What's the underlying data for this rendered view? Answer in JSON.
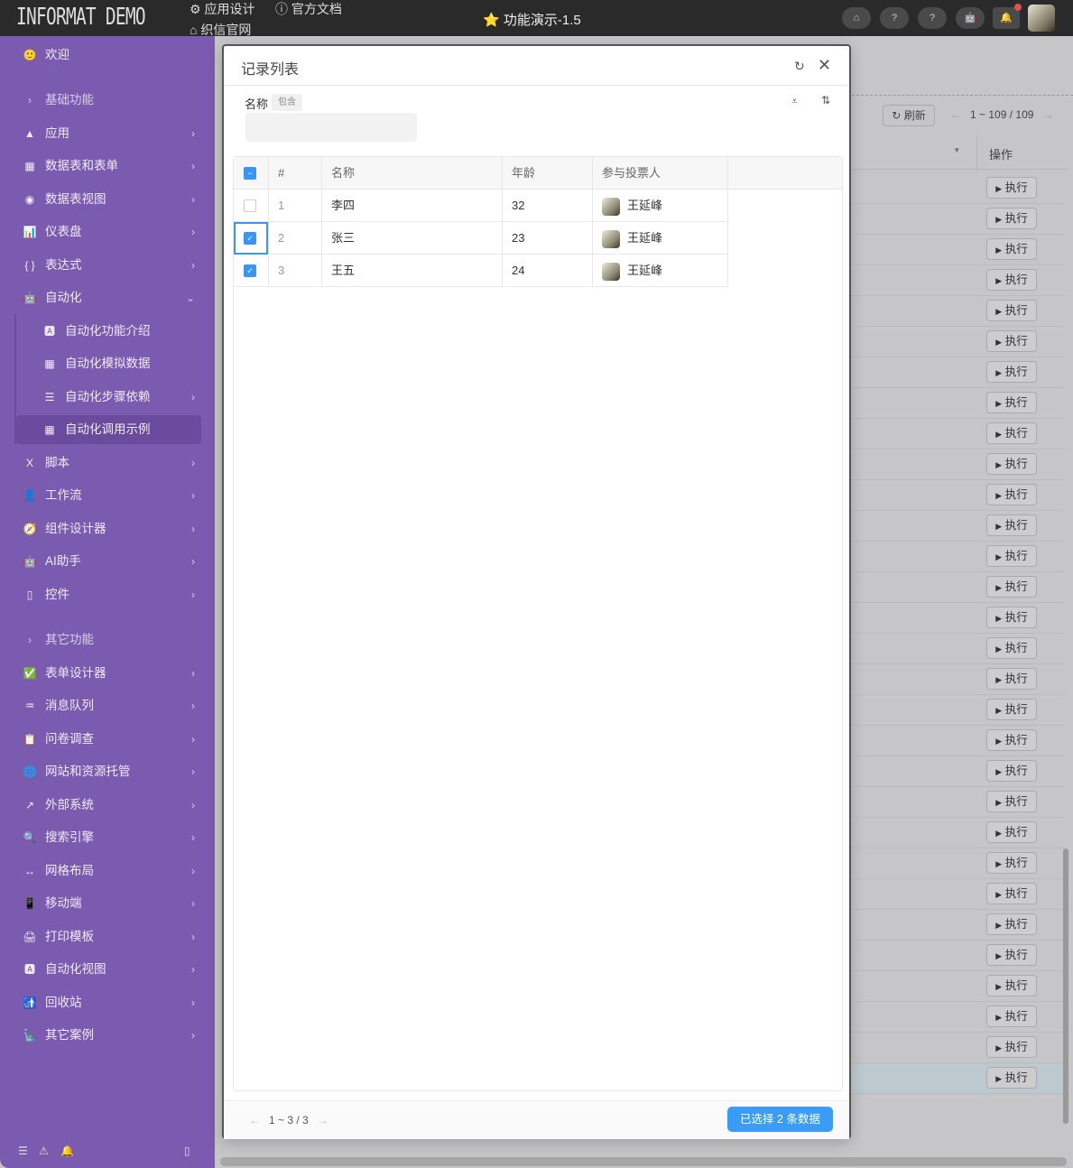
{
  "topbar": {
    "logo": "INFORMAT DEMO",
    "links": [
      {
        "icon": "gear-icon",
        "label": "应用设计"
      },
      {
        "icon": "info-icon",
        "label": "官方文档"
      },
      {
        "icon": "home-icon",
        "label": "织信官网"
      }
    ],
    "title": "功能演示-1.5",
    "title_icon": "⭐",
    "buttons": [
      {
        "name": "home",
        "icon": "⌂"
      },
      {
        "name": "feedback",
        "icon": "?"
      },
      {
        "name": "help",
        "icon": "?"
      },
      {
        "name": "robot",
        "icon": "🤖"
      },
      {
        "name": "notifications",
        "icon": "🔔"
      }
    ]
  },
  "sidebar": {
    "items": [
      {
        "icon": "🙂",
        "label": "欢迎",
        "type": "item"
      },
      {
        "icon": "›",
        "label": "基础功能",
        "type": "section"
      },
      {
        "icon": "▲",
        "label": "应用",
        "type": "item",
        "chevron": "›"
      },
      {
        "icon": "▦",
        "label": "数据表和表单",
        "type": "item",
        "chevron": "›"
      },
      {
        "icon": "◉",
        "label": "数据表视图",
        "type": "item",
        "chevron": "›"
      },
      {
        "icon": "📊",
        "label": "仪表盘",
        "type": "item",
        "chevron": "›"
      },
      {
        "icon": "{ }",
        "label": "表达式",
        "type": "item",
        "chevron": "›"
      },
      {
        "icon": "🤖",
        "label": "自动化",
        "type": "item",
        "chevron": "⌄"
      },
      {
        "icon": "🅰",
        "label": "自动化功能介绍",
        "type": "sub"
      },
      {
        "icon": "▦",
        "label": "自动化模拟数据",
        "type": "sub"
      },
      {
        "icon": "☰",
        "label": "自动化步骤依赖",
        "type": "sub",
        "chevron": "›"
      },
      {
        "icon": "▦",
        "label": "自动化调用示例",
        "type": "sub",
        "active": true
      },
      {
        "icon": "X",
        "label": "脚本",
        "type": "item",
        "chevron": "›"
      },
      {
        "icon": "👤",
        "label": "工作流",
        "type": "item",
        "chevron": "›"
      },
      {
        "icon": "🧭",
        "label": "组件设计器",
        "type": "item",
        "chevron": "›"
      },
      {
        "icon": "🤖",
        "label": "AI助手",
        "type": "item",
        "chevron": "›"
      },
      {
        "icon": "▯",
        "label": "控件",
        "type": "item",
        "chevron": "›"
      },
      {
        "icon": "›",
        "label": "其它功能",
        "type": "section"
      },
      {
        "icon": "✅",
        "label": "表单设计器",
        "type": "item",
        "chevron": "›"
      },
      {
        "icon": "♒",
        "label": "消息队列",
        "type": "item",
        "chevron": "›"
      },
      {
        "icon": "📋",
        "label": "问卷调查",
        "type": "item",
        "chevron": "›"
      },
      {
        "icon": "🌐",
        "label": "网站和资源托管",
        "type": "item",
        "chevron": "›"
      },
      {
        "icon": "↗",
        "label": "外部系统",
        "type": "item",
        "chevron": "›"
      },
      {
        "icon": "🔍",
        "label": "搜索引擎",
        "type": "item",
        "chevron": "›"
      },
      {
        "icon": "↔",
        "label": "网格布局",
        "type": "item",
        "chevron": "›"
      },
      {
        "icon": "📱",
        "label": "移动端",
        "type": "item",
        "chevron": "›"
      },
      {
        "icon": "🖨",
        "label": "打印模板",
        "type": "item",
        "chevron": "›"
      },
      {
        "icon": "🅰",
        "label": "自动化视图",
        "type": "item",
        "chevron": "›"
      },
      {
        "icon": "🚮",
        "label": "回收站",
        "type": "item",
        "chevron": "›"
      },
      {
        "icon": "🗽",
        "label": "其它案例",
        "type": "item",
        "chevron": "›"
      }
    ],
    "footer_icons": [
      "menu-icon",
      "warning-icon",
      "bell-icon",
      "panel-icon"
    ]
  },
  "background": {
    "refresh_label": "刷新",
    "pager": "1 ~ 109 / 109",
    "column_header": "操作",
    "row_button": "执行",
    "row_count": 30
  },
  "modal": {
    "title": "记录列表",
    "filter": {
      "label": "名称",
      "operator": "包含",
      "value": ""
    },
    "columns": [
      "#",
      "名称",
      "年龄",
      "参与投票人"
    ],
    "rows": [
      {
        "index": "1",
        "name": "李四",
        "age": "32",
        "voter": "王延峰",
        "checked": false
      },
      {
        "index": "2",
        "name": "张三",
        "age": "23",
        "voter": "王延峰",
        "checked": true
      },
      {
        "index": "3",
        "name": "王五",
        "age": "24",
        "voter": "王延峰",
        "checked": true
      }
    ],
    "pager": "1 ~ 3 / 3",
    "selected_button": "已选择 2 条数据"
  },
  "colors": {
    "sidebar": "#7a5bb0",
    "accent": "#3b9cf5",
    "topbar": "#2a2a2a"
  }
}
